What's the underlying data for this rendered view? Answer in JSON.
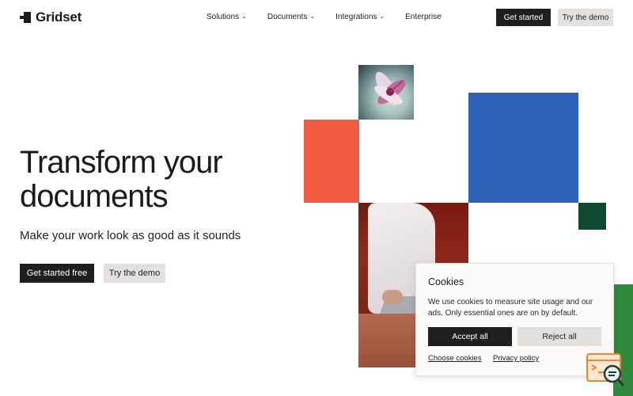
{
  "brand": {
    "name": "Gridset"
  },
  "nav": {
    "items": [
      {
        "label": "Solutions",
        "has_dropdown": true
      },
      {
        "label": "Documents",
        "has_dropdown": true
      },
      {
        "label": "Integrations",
        "has_dropdown": true
      },
      {
        "label": "Enterprise",
        "has_dropdown": false
      }
    ],
    "dropdown_icon": "chevron-down-icon"
  },
  "header": {
    "get_started_label": "Get started",
    "try_demo_label": "Try the demo"
  },
  "hero": {
    "title": "Transform your documents",
    "subtitle": "Make your work look as good as it sounds",
    "cta_primary": "Get started free",
    "cta_secondary": "Try the demo"
  },
  "cookies": {
    "title": "Cookies",
    "message": "We use cookies to measure site usage and our ads. Only essential ones are on by default.",
    "accept_label": "Accept all",
    "reject_label": "Reject all",
    "choose_label": "Choose cookies",
    "privacy_label": "Privacy policy"
  },
  "colors": {
    "orange": "#f35a42",
    "blue": "#2d62b9",
    "dark_green": "#0d4a2f",
    "green": "#2f8a3d",
    "dark_button": "#1f1f1f",
    "light_button": "#e4e1dd"
  },
  "icons": {
    "support": "chat-search-icon"
  }
}
